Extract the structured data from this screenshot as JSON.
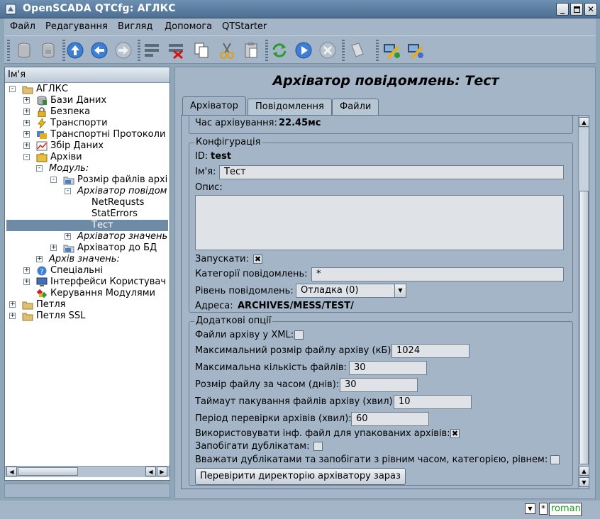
{
  "window": {
    "title": "OpenSCADA QTCfg: АГЛКС"
  },
  "menu": [
    "Файл",
    "Редагування",
    "Вигляд",
    "Допомога",
    "QTStarter"
  ],
  "toolbar_icons": [
    "db-load-icon",
    "db-save-icon",
    "up-icon",
    "back-icon",
    "forward-icon",
    "add-item-icon",
    "delete-item-icon",
    "copy-icon",
    "cut-icon",
    "paste-icon",
    "refresh-icon",
    "start-icon",
    "stop-icon",
    "info-icon",
    "user-icon",
    "settings-icon"
  ],
  "tree": {
    "header": "Ім'я",
    "items": [
      {
        "label": "АГЛКС",
        "italic": false
      },
      {
        "label": "Бази Даних",
        "italic": false
      },
      {
        "label": "Безпека",
        "italic": false
      },
      {
        "label": "Транспорти",
        "italic": false
      },
      {
        "label": "Транспортні Протоколи",
        "italic": false
      },
      {
        "label": "Збір Даних",
        "italic": false
      },
      {
        "label": "Архіви",
        "italic": false
      },
      {
        "label": "Модуль:",
        "italic": true
      },
      {
        "label": "Розмір файлів архі",
        "italic": false
      },
      {
        "label": "Архіватор повідом",
        "italic": true
      },
      {
        "label": "NetRequsts",
        "italic": false
      },
      {
        "label": "StatErrors",
        "italic": false
      },
      {
        "label": "Тест",
        "italic": false
      },
      {
        "label": "Архіватор значень",
        "italic": true
      },
      {
        "label": "Архіватор до БД",
        "italic": false
      },
      {
        "label": "Архів значень:",
        "italic": true
      },
      {
        "label": "Спеціальні",
        "italic": false
      },
      {
        "label": "Інтерфейси Користувач",
        "italic": false
      },
      {
        "label": "Керування Модулями",
        "italic": false
      },
      {
        "label": "Петля",
        "italic": false
      },
      {
        "label": "Петля SSL",
        "italic": false
      }
    ]
  },
  "page": {
    "title": "Архіватор повідомлень: Тест",
    "tabs": [
      "Архіватор",
      "Повідомлення",
      "Файли"
    ],
    "state": {
      "time_label": "Час архівування:",
      "time_value": "22.45мс"
    },
    "config": {
      "legend": "Конфігурація",
      "id_label": "ID:",
      "id_value": "test",
      "name_label": "Ім'я:",
      "name_value": "Тест",
      "descr_label": "Опис:",
      "descr_value": "",
      "start_label": "Запускати:",
      "start_checked": true,
      "categories_label": "Категорії повідомлень:",
      "categories_value": "*",
      "level_label": "Рівень повідомлень:",
      "level_value": "Отладка (0)",
      "address_label": "Адреса:",
      "address_value": "ARCHIVES/MESS/TEST/"
    },
    "extra": {
      "legend": "Додаткові опції",
      "xml_label": "Файли архіву у XML:",
      "xml_checked": false,
      "maxsize_label": "Максимальний розмір файлу архіву (кБ):",
      "maxsize_value": "1024",
      "maxfiles_label": "Максимальна кількість файлів:",
      "maxfiles_value": "30",
      "timesize_label": "Розмір файлу за часом (днів):",
      "timesize_value": "30",
      "pack_label": "Таймаут пакування файлів архіву (хвил):",
      "pack_value": "10",
      "check_label": "Період перевірки архівів (хвил):",
      "check_value": "60",
      "useinfo_label": "Використовувати інф. файл для упакованих архівів:",
      "useinfo_checked": true,
      "dupl_label": "Запобігати дублікатам:",
      "dupl_checked": false,
      "dupl_eq_label": "Вважати дублікатами та запобігати з рівним часом, категорією, рівнем:",
      "dupl_eq_checked": false,
      "check_button": "Перевірити директорію архіватору зараз"
    }
  },
  "status": {
    "mark": "*",
    "user": "roman"
  }
}
